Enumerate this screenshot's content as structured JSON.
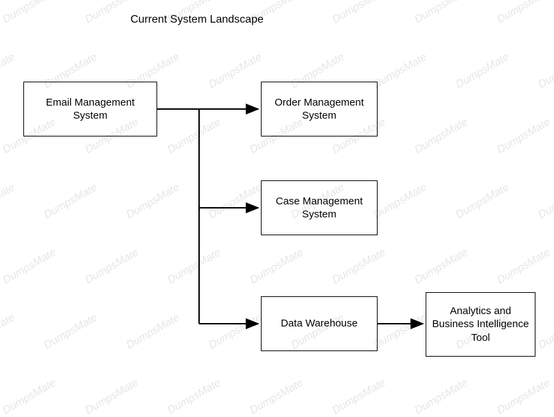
{
  "title": "Current System Landscape",
  "nodes": {
    "email": "Email Management System",
    "order": "Order Management System",
    "case": "Case Management System",
    "dw": "Data Warehouse",
    "abi": "Analytics and Business Intelligence Tool"
  },
  "watermark_text": "DumpsMate",
  "edges": [
    {
      "from": "email",
      "to": "order"
    },
    {
      "from": "email",
      "to": "case"
    },
    {
      "from": "email",
      "to": "dw"
    },
    {
      "from": "dw",
      "to": "abi"
    }
  ]
}
